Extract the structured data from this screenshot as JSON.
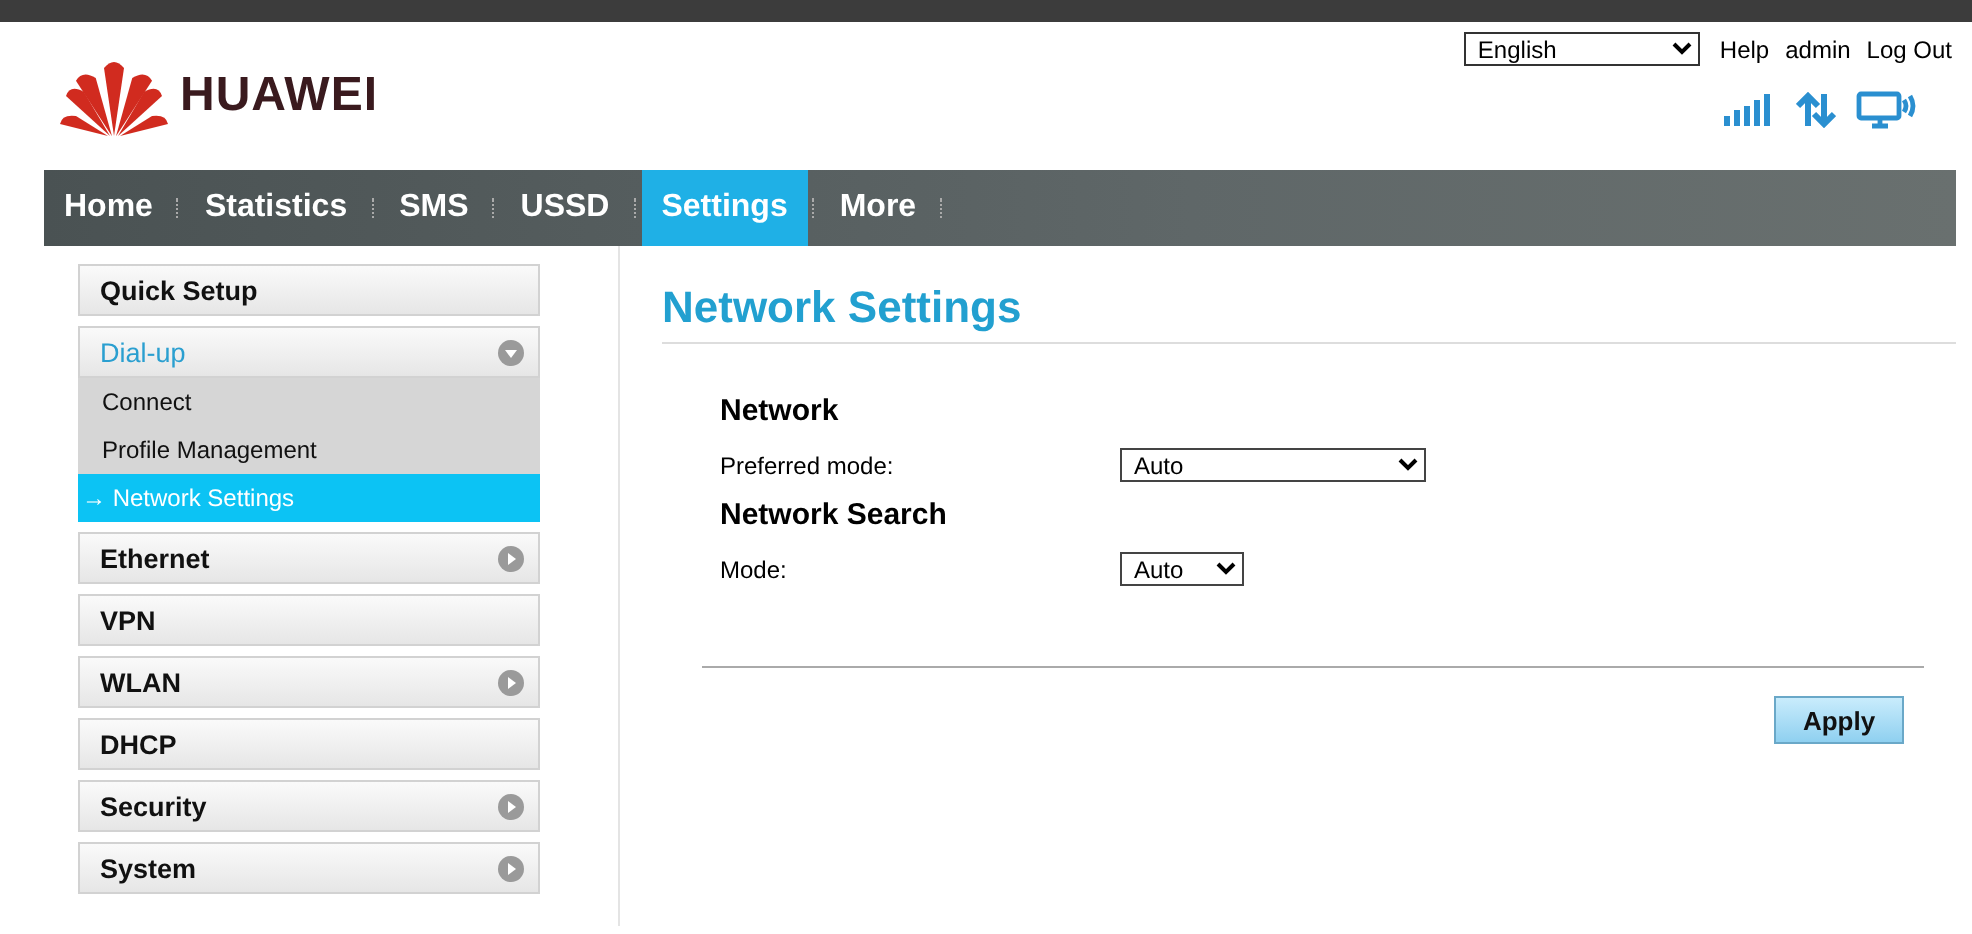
{
  "language": {
    "value": "English"
  },
  "header_links": [
    "Help",
    "admin",
    "Log Out"
  ],
  "logo": {
    "text": "HUAWEI"
  },
  "nav": [
    {
      "label": "Home",
      "selected": false
    },
    {
      "label": "Statistics",
      "selected": false
    },
    {
      "label": "SMS",
      "selected": false
    },
    {
      "label": "USSD",
      "selected": false
    },
    {
      "label": "Settings",
      "selected": true
    },
    {
      "label": "More",
      "selected": false
    }
  ],
  "sidebar": [
    {
      "label": "Quick Setup",
      "selected": false
    },
    {
      "label": "Dial-up",
      "selected": true,
      "expanded": true,
      "children": [
        {
          "label": "Connect",
          "selected": false
        },
        {
          "label": "Profile Management",
          "selected": false
        },
        {
          "label": "→ Network Settings",
          "selected": true
        }
      ]
    },
    {
      "label": "Ethernet",
      "selected": false,
      "expanded": false
    },
    {
      "label": "VPN",
      "selected": false
    },
    {
      "label": "WLAN",
      "selected": false,
      "expanded": false
    },
    {
      "label": "DHCP",
      "selected": false
    },
    {
      "label": "Security",
      "selected": false,
      "expanded": false
    },
    {
      "label": "System",
      "selected": false,
      "expanded": false
    }
  ],
  "page_title": "Network Settings",
  "sections": [
    {
      "heading": "Network",
      "fields": [
        {
          "label": "Preferred mode:",
          "value": "Auto",
          "kind": "long"
        }
      ]
    },
    {
      "heading": "Network Search",
      "fields": [
        {
          "label": "Mode:",
          "value": "Auto",
          "kind": "short"
        }
      ]
    }
  ],
  "apply_button": "Apply"
}
